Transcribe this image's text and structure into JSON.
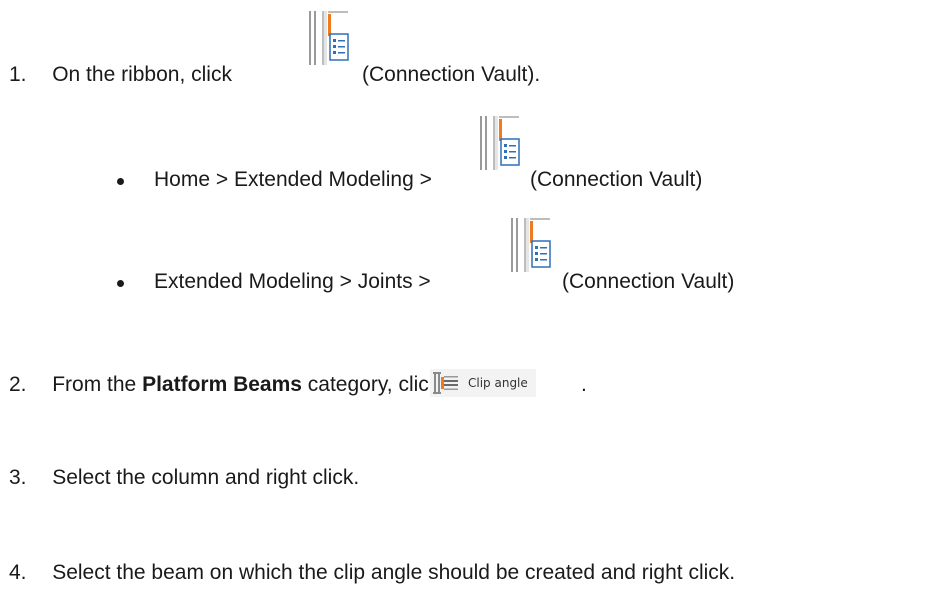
{
  "steps": [
    {
      "number": "1.",
      "before": "On the ribbon, click",
      "after": "(Connection Vault)."
    },
    {
      "number": "2.",
      "before": "From the ",
      "bold": "Platform Beams",
      "middle": " category, click",
      "button_label": "Clip angle",
      "after": "."
    },
    {
      "number": "3.",
      "text": "Select the column and right click."
    },
    {
      "number": "4.",
      "text": "Select the beam on which the clip angle should be created and right click."
    }
  ],
  "paths": [
    {
      "text": "Home > Extended Modeling >",
      "after": "(Connection Vault)"
    },
    {
      "text": "Extended Modeling > Joints >",
      "after": "(Connection Vault)"
    }
  ],
  "icons": {
    "vault": "connection-vault-icon",
    "clip": "clip-angle-icon"
  },
  "colors": {
    "accent_orange": "#f07a1e",
    "icon_blue": "#2f6fb7"
  }
}
